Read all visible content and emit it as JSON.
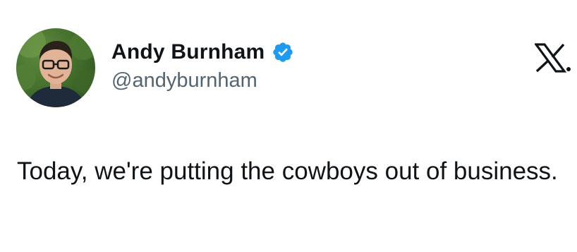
{
  "tweet": {
    "author": {
      "display_name": "Andy Burnham",
      "handle": "@andyburnham",
      "verified": true,
      "avatar_icon": "profile-photo",
      "verified_badge_color": "#1d9bf0"
    },
    "platform_logo": "x-logo",
    "text": "Today, we're putting the cowboys out of business."
  },
  "colors": {
    "primary_text": "#0f1419",
    "secondary_text": "#536471",
    "background": "#ffffff"
  }
}
